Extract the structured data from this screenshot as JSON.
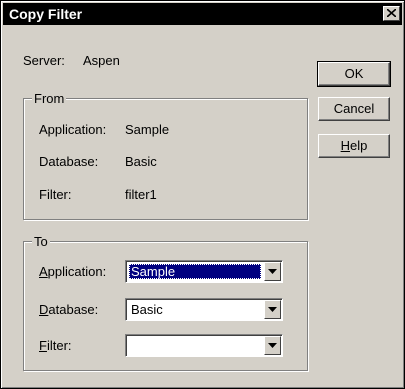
{
  "window": {
    "title": "Copy Filter"
  },
  "server": {
    "label": "Server:",
    "value": "Aspen"
  },
  "from": {
    "caption": "From",
    "application_label": "Application:",
    "application_value": "Sample",
    "database_label": "Database:",
    "database_value": "Basic",
    "filter_label": "Filter:",
    "filter_value": "filter1"
  },
  "to": {
    "caption": "To",
    "application_label_key": "A",
    "application_label_rest": "pplication:",
    "application_value": "Sample",
    "database_label_key": "D",
    "database_label_rest": "atabase:",
    "database_value": "Basic",
    "filter_label_key": "F",
    "filter_label_rest": "ilter:",
    "filter_value": ""
  },
  "buttons": {
    "ok": "OK",
    "cancel": "Cancel",
    "help_key": "H",
    "help_rest": "elp"
  },
  "icons": {
    "close": "close-icon",
    "dropdown": "chevron-down-icon"
  },
  "colors": {
    "titlebar": "#000000",
    "face": "#d4d0c8",
    "selection": "#000080"
  }
}
